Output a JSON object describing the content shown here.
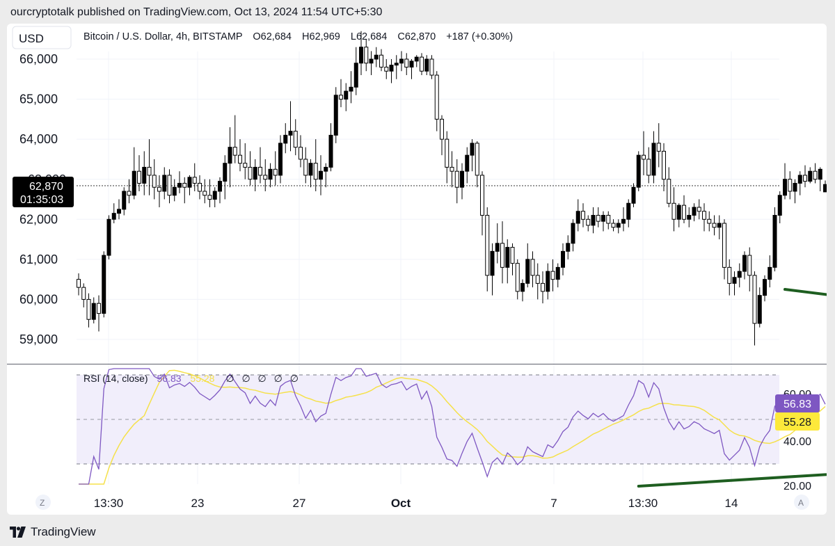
{
  "header": {
    "text": "ourcryptotalk published on TradingView.com, Oct 13, 2024 11:54 UTC+5:30"
  },
  "chart": {
    "currency_button": "USD",
    "legend": {
      "symbol": "Bitcoin / U.S. Dollar, 4h, BITSTAMP",
      "o": "O62,684",
      "h": "H62,969",
      "l": "L62,684",
      "c": "C62,870",
      "change": "+187 (+0.30%)"
    },
    "price_axis_labels": [
      "66,000",
      "65,000",
      "64,000",
      "62,000",
      "61,000",
      "60,000",
      "59,000"
    ],
    "price_axis_hidden_label": "63,000",
    "current_price_label": "62,870",
    "countdown_label": "01:35:03",
    "rsi_legend": {
      "name": "RSI (14, close)",
      "rsi": "56.83",
      "ma": "55.28",
      "symbols": [
        "∅",
        "∅",
        "∅",
        "∅",
        "∅"
      ]
    },
    "rsi_axis_labels": [
      "60.00",
      "40.00",
      "20.00"
    ],
    "rsi_value_label": "56.83",
    "rsi_ma_label": "55.28",
    "time_labels": [
      "13:30",
      "23",
      "27",
      "Oct",
      "7",
      "13:30",
      "14"
    ],
    "z_button": "Z",
    "a_button": "A"
  },
  "footer": {
    "brand": "TradingView"
  },
  "colors": {
    "candle": "#000000",
    "trendline": "#1e5e20",
    "rsi_line": "#7e57c2",
    "rsi_ma": "#f5e14a",
    "rsi_band": "#f1eefb",
    "rsi_label_bg": "#7e57c2",
    "ma_label_bg": "#fde93b"
  },
  "chart_data": {
    "type": "candlestick",
    "symbol": "Bitcoin / U.S. Dollar",
    "interval": "4h",
    "exchange": "BITSTAMP",
    "ylim": [
      58800,
      66500
    ],
    "y_ticks": [
      59000,
      60000,
      61000,
      62000,
      63000,
      64000,
      65000,
      66000
    ],
    "current_price": 62870,
    "candles": [
      [
        60500,
        60650,
        60100,
        60300
      ],
      [
        60300,
        60400,
        59800,
        60000
      ],
      [
        60000,
        60150,
        59300,
        59500
      ],
      [
        59500,
        60050,
        59400,
        59900
      ],
      [
        59900,
        60100,
        59200,
        59650
      ],
      [
        59650,
        61200,
        59550,
        61100
      ],
      [
        61100,
        62100,
        61000,
        62000
      ],
      [
        62000,
        62400,
        61900,
        62150
      ],
      [
        62150,
        62500,
        62000,
        62250
      ],
      [
        62250,
        62800,
        62100,
        62700
      ],
      [
        62700,
        63000,
        62400,
        62600
      ],
      [
        62600,
        63800,
        62500,
        63200
      ],
      [
        63200,
        63600,
        62700,
        62900
      ],
      [
        62900,
        63700,
        62600,
        63300
      ],
      [
        63300,
        64000,
        62600,
        63100
      ],
      [
        63100,
        63500,
        62500,
        62800
      ],
      [
        62800,
        63100,
        62300,
        62700
      ],
      [
        62700,
        63300,
        62500,
        63100
      ],
      [
        63100,
        63250,
        62400,
        62600
      ],
      [
        62600,
        63000,
        62450,
        62800
      ],
      [
        62800,
        63200,
        62650,
        62900
      ],
      [
        62900,
        63050,
        62400,
        62800
      ],
      [
        62800,
        63100,
        62600,
        63050
      ],
      [
        63050,
        63400,
        62700,
        62900
      ],
      [
        62900,
        63100,
        62500,
        62700
      ],
      [
        62700,
        63000,
        62400,
        62600
      ],
      [
        62600,
        63000,
        62300,
        62500
      ],
      [
        62500,
        62800,
        62300,
        62700
      ],
      [
        62700,
        63050,
        62400,
        62950
      ],
      [
        62950,
        63600,
        62500,
        63400
      ],
      [
        63400,
        64300,
        62800,
        63800
      ],
      [
        63800,
        64600,
        63400,
        63600
      ],
      [
        63600,
        64000,
        63200,
        63400
      ],
      [
        63400,
        63900,
        63000,
        63300
      ],
      [
        63300,
        63700,
        62850,
        63000
      ],
      [
        63000,
        63500,
        62700,
        63300
      ],
      [
        63300,
        63800,
        62900,
        63100
      ],
      [
        63100,
        63500,
        62700,
        63000
      ],
      [
        63000,
        63400,
        62800,
        63250
      ],
      [
        63250,
        63700,
        62850,
        63100
      ],
      [
        63100,
        64100,
        62900,
        63900
      ],
      [
        63900,
        64400,
        63650,
        64100
      ],
      [
        64100,
        64950,
        63700,
        64200
      ],
      [
        64200,
        64500,
        63600,
        63800
      ],
      [
        63800,
        64100,
        63300,
        63500
      ],
      [
        63500,
        63800,
        62900,
        63100
      ],
      [
        63100,
        63500,
        62800,
        63400
      ],
      [
        63400,
        64000,
        62700,
        63000
      ],
      [
        63000,
        63600,
        62600,
        63200
      ],
      [
        63200,
        63400,
        62800,
        63300
      ],
      [
        63300,
        64400,
        63200,
        64100
      ],
      [
        64100,
        65300,
        63900,
        65100
      ],
      [
        65100,
        65500,
        64800,
        65000
      ],
      [
        65000,
        65400,
        64700,
        65200
      ],
      [
        65200,
        65700,
        64900,
        65300
      ],
      [
        65300,
        66300,
        65100,
        65900
      ],
      [
        65900,
        66700,
        65600,
        66300
      ],
      [
        66300,
        66500,
        65700,
        65900
      ],
      [
        65900,
        66200,
        65600,
        66000
      ],
      [
        66000,
        66300,
        65800,
        66100
      ],
      [
        66100,
        66250,
        65700,
        65800
      ],
      [
        65800,
        66000,
        65500,
        65700
      ],
      [
        65700,
        66000,
        65400,
        65850
      ],
      [
        65850,
        66100,
        65500,
        65900
      ],
      [
        65900,
        66200,
        65700,
        66000
      ],
      [
        66000,
        66150,
        65600,
        65800
      ],
      [
        65800,
        66000,
        65500,
        65950
      ],
      [
        65950,
        66100,
        65800,
        66050
      ],
      [
        66050,
        66150,
        65600,
        65700
      ],
      [
        65700,
        66100,
        65600,
        66000
      ],
      [
        66000,
        66100,
        65500,
        65600
      ],
      [
        65600,
        65700,
        64200,
        64500
      ],
      [
        64500,
        64600,
        63600,
        64000
      ],
      [
        64000,
        64200,
        62900,
        63300
      ],
      [
        63300,
        63700,
        62800,
        63200
      ],
      [
        63200,
        63500,
        62400,
        62800
      ],
      [
        62800,
        63400,
        62500,
        63200
      ],
      [
        63200,
        63800,
        62900,
        63600
      ],
      [
        63600,
        64000,
        63200,
        63900
      ],
      [
        63900,
        63950,
        62800,
        63100
      ],
      [
        63100,
        63200,
        61600,
        62100
      ],
      [
        62100,
        62300,
        60200,
        60600
      ],
      [
        60600,
        61400,
        60100,
        61200
      ],
      [
        61200,
        61900,
        60900,
        61400
      ],
      [
        61400,
        61950,
        60400,
        60800
      ],
      [
        60800,
        61500,
        60400,
        61300
      ],
      [
        61300,
        61400,
        60600,
        60900
      ],
      [
        60900,
        61000,
        60000,
        60200
      ],
      [
        60200,
        60500,
        59950,
        60400
      ],
      [
        60400,
        61400,
        60300,
        61000
      ],
      [
        61000,
        61200,
        60300,
        60600
      ],
      [
        60600,
        60900,
        60000,
        60400
      ],
      [
        60400,
        60700,
        59900,
        60200
      ],
      [
        60200,
        60900,
        60000,
        60700
      ],
      [
        60700,
        61000,
        60200,
        60500
      ],
      [
        60500,
        60900,
        60300,
        60800
      ],
      [
        60800,
        61400,
        60600,
        61200
      ],
      [
        61200,
        61600,
        61000,
        61400
      ],
      [
        61400,
        62000,
        61200,
        61900
      ],
      [
        61900,
        62500,
        61700,
        62200
      ],
      [
        62200,
        62400,
        61800,
        62000
      ],
      [
        62000,
        62100,
        61700,
        61850
      ],
      [
        61850,
        62300,
        61650,
        62100
      ],
      [
        62100,
        62300,
        61800,
        61950
      ],
      [
        61950,
        62200,
        61700,
        62100
      ],
      [
        62100,
        62200,
        61750,
        61900
      ],
      [
        61900,
        62000,
        61700,
        61800
      ],
      [
        61800,
        62000,
        61650,
        61900
      ],
      [
        61900,
        62300,
        61700,
        62000
      ],
      [
        62000,
        62500,
        61800,
        62400
      ],
      [
        62400,
        62900,
        62300,
        62800
      ],
      [
        62800,
        63700,
        62700,
        63600
      ],
      [
        63600,
        64200,
        63100,
        63500
      ],
      [
        63500,
        63800,
        62900,
        63100
      ],
      [
        63100,
        64200,
        62900,
        63900
      ],
      [
        63900,
        64400,
        63300,
        63700
      ],
      [
        63700,
        63900,
        62700,
        63000
      ],
      [
        63000,
        63300,
        62300,
        62400
      ],
      [
        62400,
        62800,
        61700,
        62000
      ],
      [
        62000,
        62400,
        61800,
        62350
      ],
      [
        62350,
        62600,
        61900,
        62000
      ],
      [
        62000,
        62300,
        61800,
        62100
      ],
      [
        62100,
        62400,
        61950,
        62300
      ],
      [
        62300,
        62500,
        62000,
        62200
      ],
      [
        62200,
        62400,
        61700,
        62000
      ],
      [
        62000,
        62200,
        61700,
        61900
      ],
      [
        61900,
        62100,
        61600,
        61800
      ],
      [
        61800,
        62100,
        61500,
        61900
      ],
      [
        61900,
        62000,
        60500,
        60800
      ],
      [
        60800,
        61000,
        60100,
        60400
      ],
      [
        60400,
        60700,
        60100,
        60550
      ],
      [
        60550,
        60900,
        60300,
        60700
      ],
      [
        60700,
        61200,
        60500,
        61100
      ],
      [
        61100,
        61300,
        60200,
        60600
      ],
      [
        60600,
        60700,
        58850,
        59400
      ],
      [
        59400,
        60300,
        59300,
        60100
      ],
      [
        60100,
        60600,
        59950,
        60500
      ],
      [
        60500,
        61100,
        60300,
        60800
      ],
      [
        60800,
        62300,
        60700,
        62100
      ],
      [
        62100,
        62700,
        61900,
        62600
      ],
      [
        62600,
        63400,
        62500,
        63000
      ],
      [
        63000,
        63200,
        62500,
        62700
      ],
      [
        62700,
        63000,
        62400,
        62900
      ],
      [
        62900,
        63200,
        62600,
        63100
      ],
      [
        63100,
        63350,
        62800,
        62950
      ],
      [
        62950,
        63300,
        62900,
        63200
      ],
      [
        63200,
        63400,
        62900,
        63000
      ],
      [
        63000,
        63300,
        62700,
        63250
      ],
      [
        62684,
        62969,
        62684,
        62870
      ]
    ],
    "rsi": {
      "name": "RSI (14, close)",
      "length": 14,
      "last_value": 56.83,
      "ma_last_value": 55.28,
      "bands": [
        70,
        50,
        30
      ],
      "ylim": [
        20,
        72
      ],
      "y_ticks": [
        20,
        40,
        60
      ]
    },
    "trendlines": [
      {
        "pane": "price",
        "from": [
          140,
          60250
        ],
        "to": [
          207,
          59200
        ]
      },
      {
        "pane": "rsi",
        "from": [
          111,
          20
        ],
        "to": [
          182,
          30
        ]
      }
    ]
  }
}
